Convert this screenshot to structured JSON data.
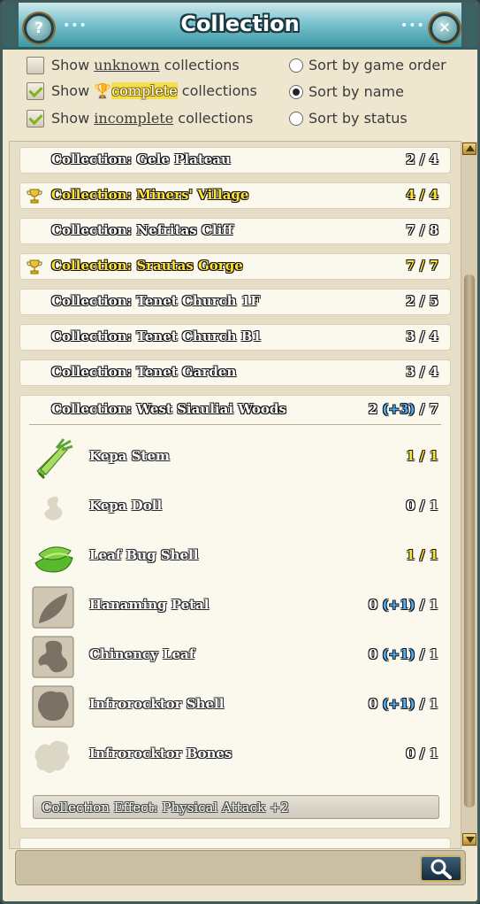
{
  "window": {
    "title": "Collection"
  },
  "filters": {
    "show_unknown": {
      "prefix": "Show",
      "keyword": "unknown",
      "suffix": "collections",
      "checked": false
    },
    "show_complete": {
      "prefix": "Show",
      "keyword": "complete",
      "suffix": "collections",
      "checked": true
    },
    "show_incomplete": {
      "prefix": "Show",
      "keyword": "incomplete",
      "suffix": "collections",
      "checked": true
    }
  },
  "sort": {
    "options": [
      "Sort by game order",
      "Sort by name",
      "Sort by status"
    ],
    "selected": "Sort by name"
  },
  "collections": [
    {
      "name": "Collection: Gele Plateau",
      "count": "2 / 4",
      "complete": false
    },
    {
      "name": "Collection: Miners' Village",
      "count": "4 / 4",
      "complete": true
    },
    {
      "name": "Collection: Nefritas Cliff",
      "count": "7 / 8",
      "complete": false
    },
    {
      "name": "Collection: Srautas Gorge",
      "count": "7 / 7",
      "complete": true
    },
    {
      "name": "Collection: Tenet Church 1F",
      "count": "2 / 5",
      "complete": false
    },
    {
      "name": "Collection: Tenet Church B1",
      "count": "3 / 4",
      "complete": false
    },
    {
      "name": "Collection: Tenet Garden",
      "count": "3 / 4",
      "complete": false
    }
  ],
  "expanded": {
    "name": "Collection: West Siauliai Woods",
    "have": "2",
    "bonus": "(+3)",
    "total": "/ 7",
    "items": [
      {
        "name": "Kepa Stem",
        "count": "1 / 1",
        "complete": true,
        "icon": "kepa-stem-icon"
      },
      {
        "name": "Kepa Doll",
        "count": "0 / 1",
        "complete": false,
        "icon": "kepa-doll-icon"
      },
      {
        "name": "Leaf Bug Shell",
        "count": "1 / 1",
        "complete": true,
        "icon": "leaf-bug-shell-icon"
      },
      {
        "name": "Hanaming Petal",
        "have": "0",
        "bonus": "(+1)",
        "total": "/ 1",
        "icon": "hanaming-petal-icon"
      },
      {
        "name": "Chinency Leaf",
        "have": "0",
        "bonus": "(+1)",
        "total": "/ 1",
        "icon": "chinency-leaf-icon"
      },
      {
        "name": "Infrorocktor Shell",
        "have": "0",
        "bonus": "(+1)",
        "total": "/ 1",
        "icon": "infrorocktor-shell-icon"
      },
      {
        "name": "Infrorocktor Bones",
        "count": "0 / 1",
        "complete": false,
        "icon": "infrorocktor-bones-icon"
      }
    ],
    "effect": "Collection Effect: Physical Attack +2"
  },
  "search": {
    "value": "",
    "placeholder": ""
  },
  "colors": {
    "gold": "#ffe232",
    "bonus": "#4cb0ff",
    "teal": "#3c98a6"
  }
}
